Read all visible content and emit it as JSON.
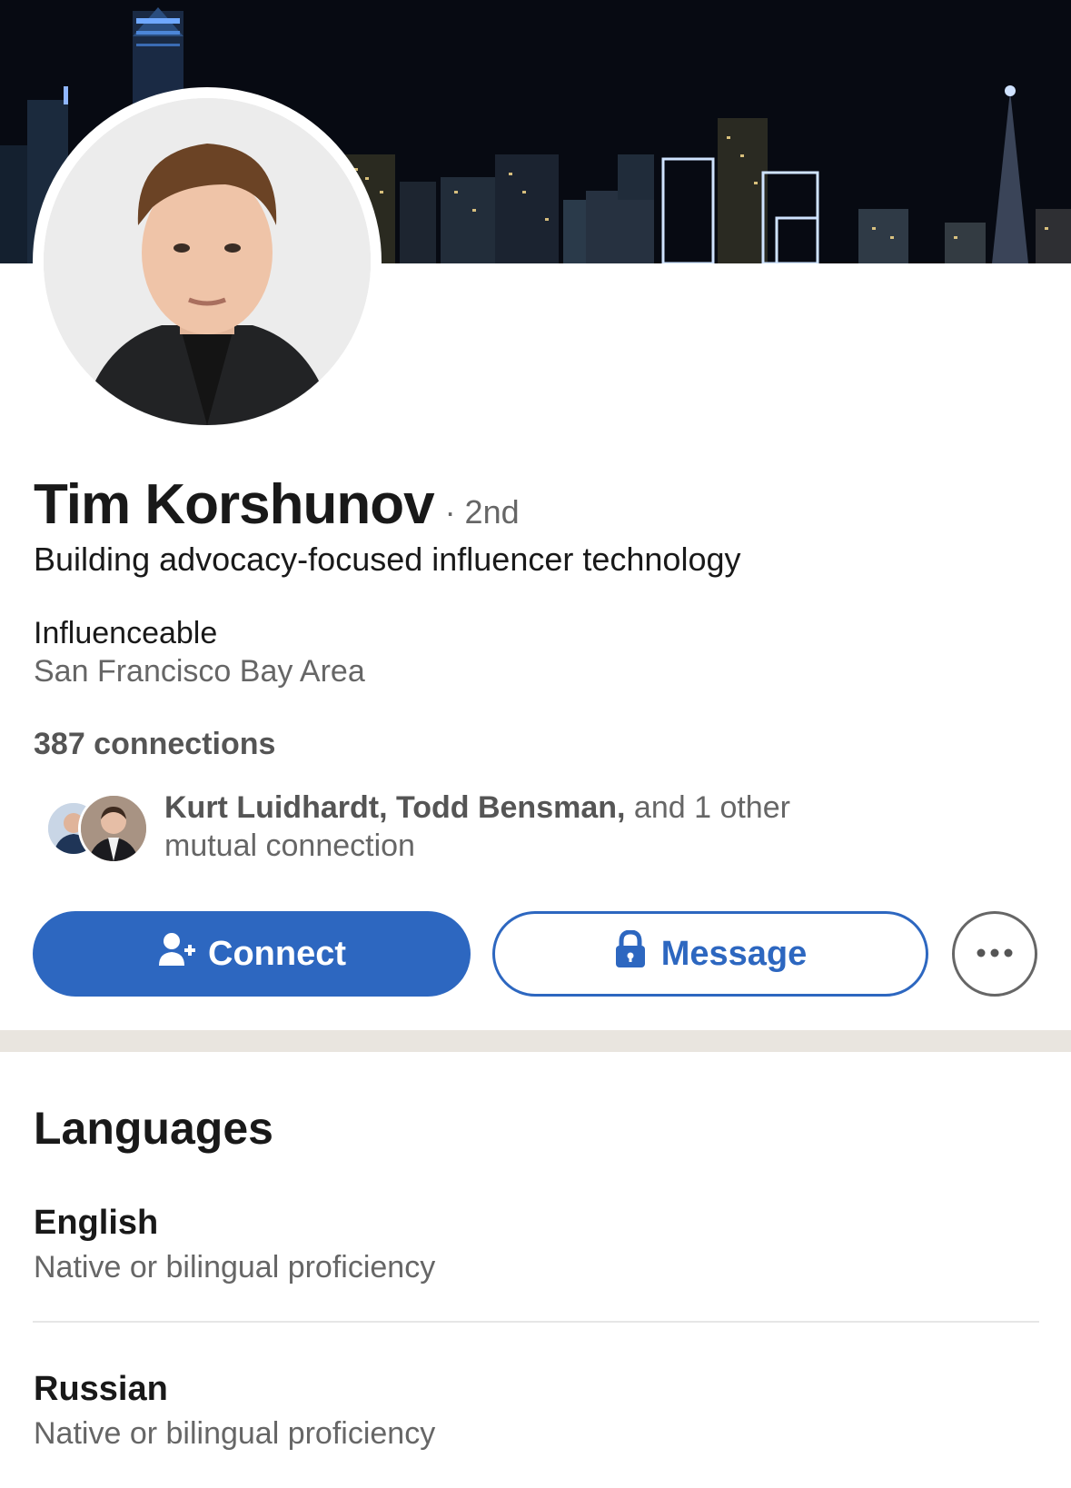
{
  "profile": {
    "name": "Tim Korshunov",
    "degree": "· 2nd",
    "headline": "Building advocacy-focused influencer technology",
    "company": "Influenceable",
    "location": "San Francisco Bay Area",
    "connections": "387 connections"
  },
  "mutual": {
    "names": "Kurt Luidhardt, Todd Bensman,",
    "rest_line1": " and 1 other",
    "rest_line2": "mutual connection"
  },
  "actions": {
    "connect_label": "Connect",
    "message_label": "Message",
    "more_icon": "ellipsis-icon"
  },
  "languages": {
    "title": "Languages",
    "items": [
      {
        "name": "English",
        "level": "Native or bilingual proficiency"
      },
      {
        "name": "Russian",
        "level": "Native or bilingual proficiency"
      }
    ]
  },
  "colors": {
    "accent": "#2d67c0",
    "text_primary": "#191919",
    "text_secondary": "#666666",
    "band": "#e9e5df"
  }
}
